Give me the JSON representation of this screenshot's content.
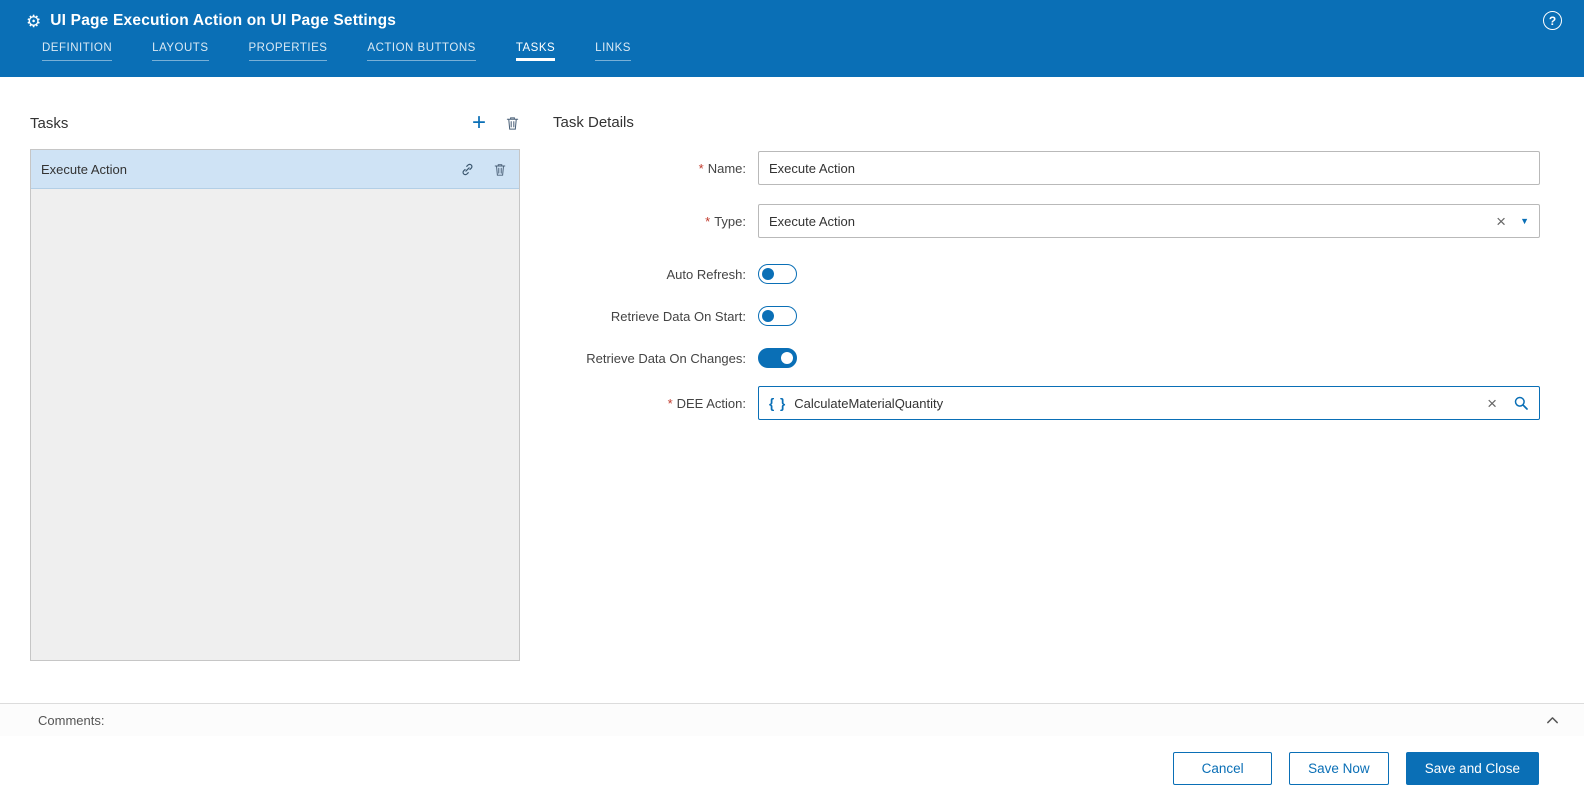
{
  "header": {
    "title": "UI Page Execution Action on UI Page Settings"
  },
  "icons": {
    "gear": "⚙",
    "help": "?",
    "add": "+",
    "clear": "×",
    "caret_down": "▼",
    "braces": "{ }",
    "trash": "trash-icon",
    "link": "link-icon",
    "search": "search-icon",
    "chevron_up": "chevron-up-icon"
  },
  "tabs": [
    {
      "label": "DEFINITION",
      "active": false
    },
    {
      "label": "LAYOUTS",
      "active": false
    },
    {
      "label": "PROPERTIES",
      "active": false
    },
    {
      "label": "ACTION BUTTONS",
      "active": false
    },
    {
      "label": "TASKS",
      "active": true
    },
    {
      "label": "LINKS",
      "active": false
    }
  ],
  "tasks_panel": {
    "title": "Tasks",
    "items": [
      {
        "label": "Execute Action",
        "selected": true
      }
    ]
  },
  "task_details": {
    "title": "Task Details",
    "required_marker": "*",
    "name": {
      "label": "Name:",
      "required": true,
      "value": "Execute Action"
    },
    "type": {
      "label": "Type:",
      "required": true,
      "value": "Execute Action"
    },
    "auto_refresh": {
      "label": "Auto Refresh:",
      "state": "off"
    },
    "retrieve_data_on_start": {
      "label": "Retrieve Data On Start:",
      "state": "off"
    },
    "retrieve_data_on_changes": {
      "label": "Retrieve Data On Changes:",
      "state": "on"
    },
    "dee_action": {
      "label": "DEE Action:",
      "required": true,
      "value": "CalculateMaterialQuantity"
    }
  },
  "comments": {
    "label": "Comments:"
  },
  "footer": {
    "cancel": "Cancel",
    "save_now": "Save Now",
    "save_and_close": "Save and Close"
  },
  "colors": {
    "header_blue": "#0a6fb6",
    "selected_row": "#cfe3f5",
    "required_red": "#c0392b",
    "tab_underline_active": "#ffffff"
  }
}
